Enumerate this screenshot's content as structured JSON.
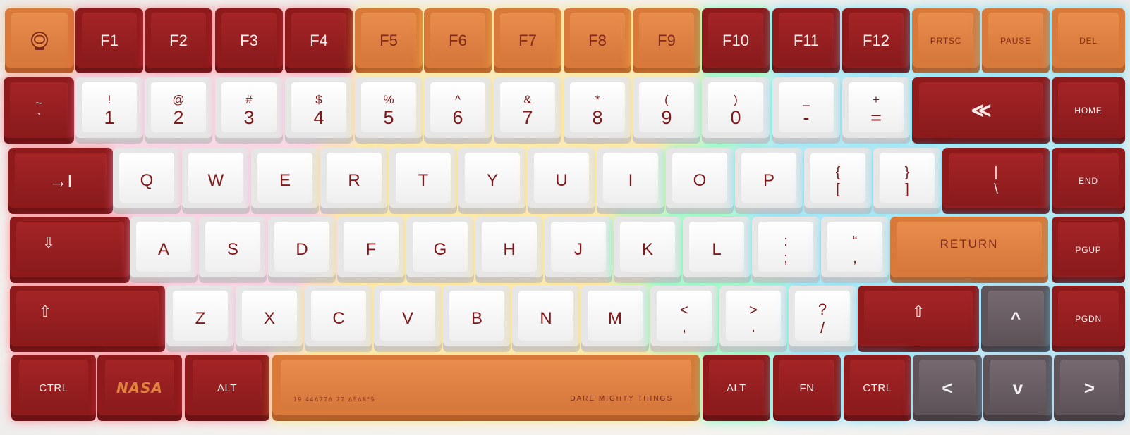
{
  "keyboard": {
    "colors": {
      "red": "#8e1a1b",
      "orange": "#d9793a",
      "white": "#f4f3f3",
      "gray": "#5d5358",
      "legend_red": "#7c1a1c"
    },
    "row0": {
      "esc_icon": "astronaut-helmet-icon",
      "f1": "F1",
      "f2": "F2",
      "f3": "F3",
      "f4": "F4",
      "f5": "F5",
      "f6": "F6",
      "f7": "F7",
      "f8": "F8",
      "f9": "F9",
      "f10": "F10",
      "f11": "F11",
      "f12": "F12",
      "prtsc": "PRTSC",
      "pause": "PAUSE",
      "del": "DEL"
    },
    "row1": {
      "grave_top": "~",
      "grave_bot": "`",
      "k1_top": "!",
      "k1_bot": "1",
      "k2_top": "@",
      "k2_bot": "2",
      "k3_top": "#",
      "k3_bot": "3",
      "k4_top": "$",
      "k4_bot": "4",
      "k5_top": "%",
      "k5_bot": "5",
      "k6_top": "^",
      "k6_bot": "6",
      "k7_top": "&",
      "k7_bot": "7",
      "k8_top": "*",
      "k8_bot": "8",
      "k9_top": "(",
      "k9_bot": "9",
      "k0_top": ")",
      "k0_bot": "0",
      "minus_top": "_",
      "minus_bot": "-",
      "equal_top": "+",
      "equal_bot": "=",
      "backspace": "≪",
      "home": "HOME"
    },
    "row2": {
      "tab": "→I",
      "q": "Q",
      "w": "W",
      "e": "E",
      "r": "R",
      "t": "T",
      "y": "Y",
      "u": "U",
      "i": "I",
      "o": "O",
      "p": "P",
      "lbracket_top": "{",
      "lbracket_bot": "[",
      "rbracket_top": "}",
      "rbracket_bot": "]",
      "backslash_top": "|",
      "backslash_bot": "\\",
      "end": "END"
    },
    "row3": {
      "caps": "⇩",
      "a": "A",
      "s": "S",
      "d": "D",
      "f": "F",
      "g": "G",
      "h": "H",
      "j": "J",
      "k": "K",
      "l": "L",
      "semicolon_top": ":",
      "semicolon_bot": ";",
      "quote_top": "“",
      "quote_bot": ",",
      "return": "RETURN",
      "pgup": "PGUP"
    },
    "row4": {
      "lshift": "⇧",
      "z": "Z",
      "x": "X",
      "c": "C",
      "v": "V",
      "b": "B",
      "n": "N",
      "m": "M",
      "comma_top": "<",
      "comma_bot": ",",
      "period_top": ">",
      "period_bot": ".",
      "slash_top": "?",
      "slash_bot": "/",
      "rshift": "⇧",
      "up": "^",
      "pgdn": "PGDN"
    },
    "row5": {
      "lctrl": "CTRL",
      "nasa": "NASA",
      "lalt": "ALT",
      "space_left": "19 44∆77∆ 77 ∆5∆8*5",
      "space_right": "DARE MIGHTY THINGS",
      "ralt": "ALT",
      "fn": "FN",
      "rctrl": "CTRL",
      "left": "<",
      "down": "v",
      "right": ">"
    }
  }
}
